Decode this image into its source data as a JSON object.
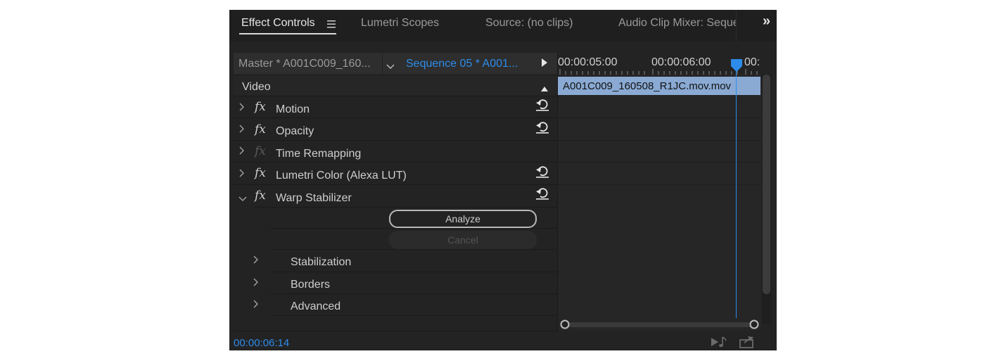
{
  "tabs": [
    {
      "label": "Effect Controls",
      "active": true
    },
    {
      "label": "Lumetri Scopes",
      "active": false
    },
    {
      "label": "Source: (no clips)",
      "active": false
    },
    {
      "label": "Audio Clip Mixer: Seque",
      "active": false
    }
  ],
  "tab_overflow_glyph": "»",
  "source_selector": {
    "master_label": "Master * A001C009_160...",
    "sequence_label": "Sequence 05 * A001..."
  },
  "timeline": {
    "timecodes": [
      "00:00:05:00",
      "00:00:06:00",
      "00:"
    ],
    "clip_name": "A001C009_160508_R1JC.mov.mov"
  },
  "section_header": "Video",
  "effects": [
    {
      "label": "Motion",
      "enabled": true
    },
    {
      "label": "Opacity",
      "enabled": true
    },
    {
      "label": "Time Remapping",
      "enabled": false
    },
    {
      "label": "Lumetri Color (Alexa LUT)",
      "enabled": true
    },
    {
      "label": "Warp Stabilizer",
      "enabled": true
    }
  ],
  "fx_glyph": "fx",
  "warp": {
    "analyze_label": "Analyze",
    "cancel_label": "Cancel",
    "groups": [
      "Stabilization",
      "Borders",
      "Advanced"
    ]
  },
  "current_time": "00:00:06:14",
  "colors": {
    "accent": "#2d8ceb",
    "clip": "#8aaad4",
    "panel_bg": "#232323",
    "tab_bar_bg": "#1f1f1f"
  }
}
